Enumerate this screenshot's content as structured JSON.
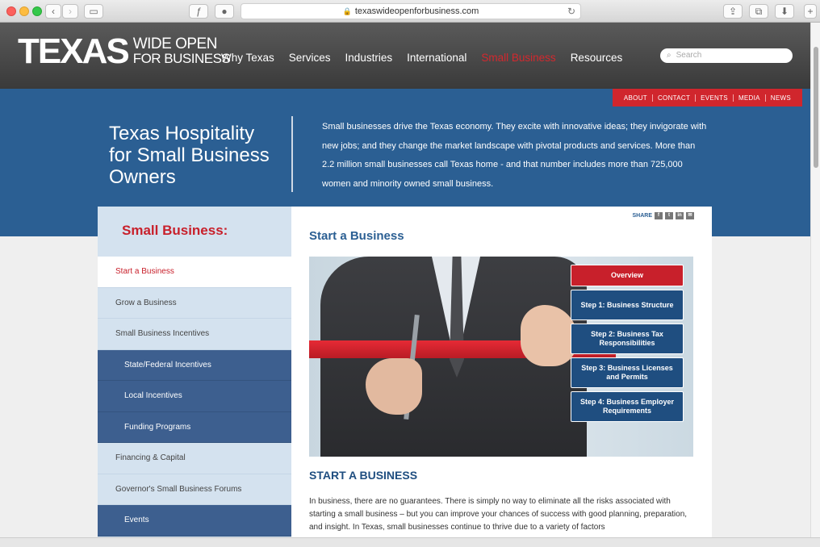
{
  "browser": {
    "url": "texaswideopenforbusiness.com"
  },
  "header": {
    "logo_main": "TEXAS",
    "logo_line1": "WIDE OPEN",
    "logo_line2": "FOR BUSINESS",
    "nav": [
      "Why Texas",
      "Services",
      "Industries",
      "International",
      "Small Business",
      "Resources"
    ],
    "active_nav": "Small Business",
    "search_placeholder": "Search"
  },
  "utility_nav": [
    "ABOUT",
    "CONTACT",
    "EVENTS",
    "MEDIA",
    "NEWS"
  ],
  "hero": {
    "title": "Texas Hospitality for Small Business Owners",
    "text": "Small businesses drive the Texas economy. They excite with innovative ideas; they invigorate with new jobs; and they change the market landscape with pivotal products and services. More than 2.2 million small businesses call Texas home - and that number includes more than 725,000 women and minority owned small business."
  },
  "sidebar": {
    "heading": "Small Business:",
    "items": [
      {
        "label": "Start a Business",
        "type": "active"
      },
      {
        "label": "Grow a Business",
        "type": "normal"
      },
      {
        "label": "Small Business Incentives",
        "type": "normal"
      },
      {
        "label": "State/Federal Incentives",
        "type": "sub"
      },
      {
        "label": "Local Incentives",
        "type": "sub"
      },
      {
        "label": "Funding Programs",
        "type": "sub"
      },
      {
        "label": "Financing & Capital",
        "type": "normal"
      },
      {
        "label": "Governor's Small Business Forums",
        "type": "normal"
      },
      {
        "label": "Events",
        "type": "sub"
      }
    ]
  },
  "main": {
    "share_label": "SHARE",
    "title": "Start a Business",
    "steps": [
      "Overview",
      "Step 1: Business Structure",
      "Step 2: Business Tax Responsibilities",
      "Step 3: Business Licenses and Permits",
      "Step 4: Business Employer Requirements"
    ],
    "section_heading": "START A BUSINESS",
    "body": "In business, there are no guarantees. There is simply no way to eliminate all the risks associated with starting a small business – but you can improve your chances of success with good planning, preparation, and insight. In Texas, small businesses continue to thrive due to a variety of factors"
  },
  "colors": {
    "brand_red": "#c8202b",
    "brand_blue": "#2b5f93",
    "header_dark": "#3a3a3a"
  }
}
